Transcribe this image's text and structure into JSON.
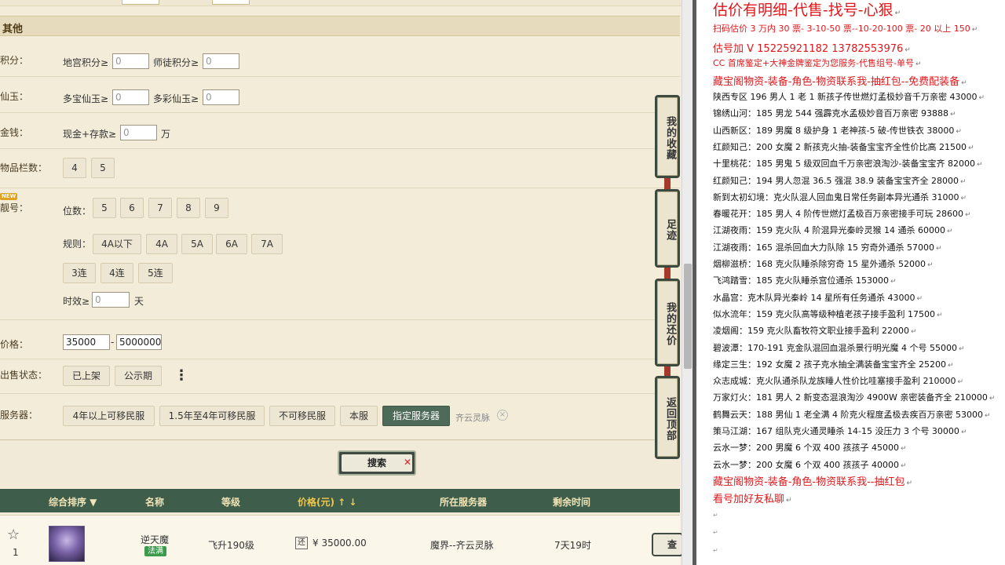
{
  "filter": {
    "section_title": "其他",
    "points": {
      "label": "积分：",
      "dungeon": "地宫积分≥",
      "dungeon_ph": "0",
      "mentor": "师徒积分≥",
      "mentor_ph": "0"
    },
    "jade": {
      "label": "仙玉：",
      "multi": "多宝仙玉≥",
      "multi_ph": "0",
      "color": "多彩仙玉≥",
      "color_ph": "0"
    },
    "money": {
      "label": "金钱：",
      "cash": "现金+存款≥",
      "cash_ph": "0",
      "unit": "万"
    },
    "slots": {
      "label": "物品栏数：",
      "options": [
        "4",
        "5"
      ]
    },
    "number": {
      "label": "靓号：",
      "new_tag": "NEW",
      "digits_label": "位数：",
      "digits": [
        "5",
        "6",
        "7",
        "8",
        "9"
      ],
      "rule_label": "规则：",
      "rules": [
        "4A以下",
        "4A",
        "5A",
        "6A",
        "7A"
      ],
      "rules2": [
        "3连",
        "4连",
        "5连"
      ],
      "valid_label": "时效≥",
      "valid_ph": "0",
      "valid_unit": "天"
    },
    "price": {
      "label": "价格：",
      "min": "35000",
      "sep": "-",
      "max": "5000000"
    },
    "sale": {
      "label": "出售状态：",
      "options": [
        "已上架",
        "公示期"
      ],
      "more": "⋮"
    },
    "server": {
      "label": "服务器：",
      "options": [
        "4年以上可移民服",
        "1.5年至4年可移民服",
        "不可移民服",
        "本服",
        "指定服务器"
      ],
      "selected": "齐云灵脉",
      "clear": "×"
    },
    "search_label": "搜索",
    "search_x": "✕"
  },
  "table": {
    "headers": [
      "综合排序 ▼",
      "名称",
      "等级",
      "价格(元) ↑  ↓",
      "所在服务器",
      "剩余时间"
    ],
    "row": {
      "index": "1",
      "star": "☆",
      "name": "逆天魔",
      "tag": "法满",
      "level": "飞升190级",
      "price_icon": "还",
      "price": "¥ 35000.00",
      "server": "魔界--齐云灵脉",
      "remaining": "7天19时",
      "view": "查"
    }
  },
  "side_menu": [
    "我的收藏",
    "足迹",
    "我的还价",
    "返回顶部"
  ],
  "notes": {
    "header_lines": [
      {
        "text": "估价有明细-代售-找号-心狠",
        "style": "red big"
      },
      {
        "text": "扫码估价 3 万内 30 票- 3-10-50 票--10-20-100 票- 20 以上 150",
        "style": "red"
      },
      {
        "text": "估号加 V 15225921182   13782553976",
        "style": "red med"
      },
      {
        "text": "CC 首席鉴定+大神金牌鉴定为您服务-代售组号-单号",
        "style": "red"
      },
      {
        "text": "藏宝阁物资-装备-角色-物资联系我-抽红包--免费配装备",
        "style": "red med"
      }
    ],
    "listings": [
      "陕西专区 196 男人 1 老 1 新孩子传世燃灯孟极妙音千万亲密 43000",
      "锦绣山河：185 男龙 544 强霹克水孟极妙音百万亲密 93888",
      "山西新区：189 男魔 8 级护身 1 老神孩-5 破-传世铁衣 38000",
      "红颜知己：200 女魔 2 新孩克火抽-装备宝宝齐全性价比高 21500",
      "十里桃花：185 男鬼 5 级双回血千万亲密浪淘沙-装备宝宝齐 82000",
      "红颜知己：194 男人忽混 36.5 强混 38.9 装备宝宝齐全 28000",
      "新到太初幻境：克火队混人回血鬼日常任务副本异光通杀 31000",
      "春暖花开：185 男人 4 阶传世燃灯孟极百万亲密接手可玩 28600",
      "江湖夜雨：159 克火队 4 阶混异光秦岭灵猴 14 通杀 60000",
      "江湖夜雨：165 混杀回血大力队除 15 穷奇外通杀 57000",
      "烟柳滋桥：168 克火队睡杀除穷奇 15 星外通杀 52000",
      "飞鸿踏雪：185 克火队睡杀宫位通杀 153000",
      "水晶宫：克木队异光秦岭 14 星所有任务通杀 43000",
      "似水流年：159 克火队高等级种植老孩子接手盈利 17500",
      "凌烟阁：159 克火队畜牧符文职业接手盈利 22000",
      "碧波潭：170-191 克金队混回血混杀景行明光魔 4 个号 55000",
      "缘定三生：192 女魔 2 孩子克水抽全满装备宝宝齐全 25200",
      "众志成城：克火队通杀队龙族睡人性价比哇塞接手盈利 210000",
      "万家灯火：181 男人 2 新变态混浪淘沙 4900W 亲密装备齐全 210000",
      "鹤舞云天：188 男仙 1 老全满 4 阶克火程度孟极去疾百万亲密 53000",
      "策马江湖：167 组队克火通灵睡杀 14-15 没压力 3 个号 30000",
      "云水一梦：200 男魔 6 个双 400 孩孩子 45000",
      "云水一梦：200 女魔 6 个双 400 孩孩子 40000"
    ],
    "footer_lines": [
      {
        "text": "藏宝阁物资-装备-角色-物资联系我--抽红包",
        "style": "red med"
      },
      {
        "text": "看号加好友私聊",
        "style": "red med"
      }
    ],
    "return_mark": "↵"
  },
  "colors": {
    "panel_bg": "#f3ecd9",
    "header_green": "#3f5d4b",
    "note_red": "#e0181c",
    "selected_server_btn": "#4e6b5a"
  }
}
